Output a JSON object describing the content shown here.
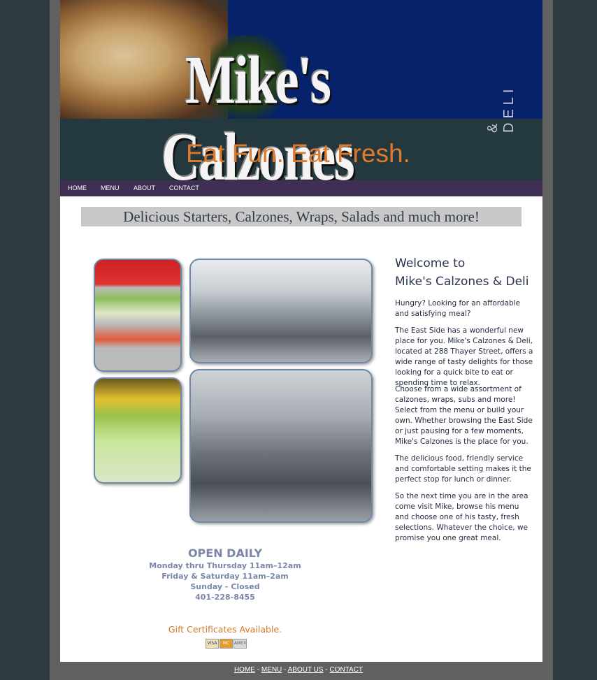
{
  "header": {
    "logo_text": "Mike's Calzones",
    "logo_subtext": "& DELI",
    "tagline": "Eat Fun. Eat Fresh."
  },
  "nav": {
    "items": [
      "HOME",
      "MENU",
      "ABOUT",
      "CONTACT"
    ]
  },
  "headline": "Delicious Starters, Calzones, Wraps, Salads and much more!",
  "welcome": {
    "title_line1": "Welcome to",
    "title_line2": "Mike's Calzones & Deli",
    "paragraphs": [
      "Hungry? Looking for an affordable and satisfying meal?",
      "The East Side has a wonderful new place for you. Mike's Calzones & Deli, located at 288 Thayer Street, offers a wide range of tasty delights for those looking for a quick bite to eat or spending time to relax.",
      "Choose from a wide assortment of calzones, wraps, subs and more! Select from the menu or build your own. Whether browsing the East Side or just pausing for a few moments, Mike's Calzones is the place for you.",
      "The delicious food, friendly service and comfortable setting makes it the perfect stop for lunch or dinner.",
      "So the next time you are in the area come visit Mike, browse his menu and choose one of his tasty, fresh selections. Whatever the choice, we promise you one great meal."
    ]
  },
  "hours": {
    "heading": "OPEN DAILY",
    "lines": [
      "Monday thru Thursday  11am–12am",
      "Friday & Saturday  11am–2am",
      "Sunday - Closed",
      "401-228-8455"
    ]
  },
  "gift": "Gift Certificates Available.",
  "cards": [
    "VISA",
    "MC",
    "AMEX"
  ],
  "footer": {
    "links": [
      "HOME",
      "MENU",
      "ABOUT US",
      "CONTACT"
    ],
    "separator": " - "
  },
  "colors": {
    "background": "#2e3b41",
    "nav": "#3f2f53",
    "banner_blue": "#06226a",
    "tagline": "#e07a2a",
    "hours_text": "#7a87a8",
    "gift_text": "#d47a26"
  }
}
